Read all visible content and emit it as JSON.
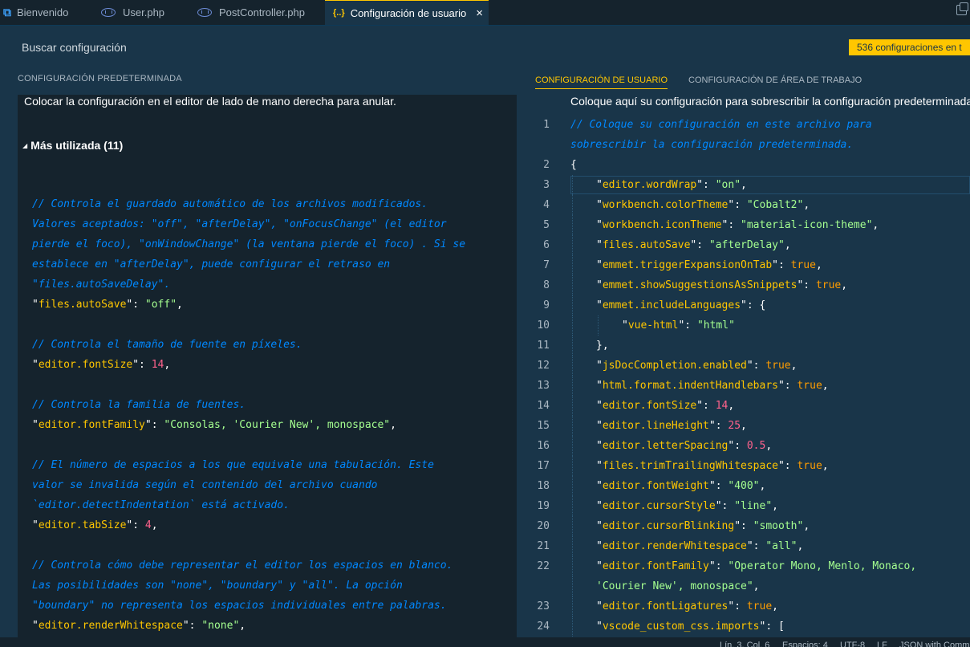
{
  "tabs": [
    {
      "label": "Bienvenido",
      "icon": "vscode-logo-icon"
    },
    {
      "label": "User.php",
      "icon": "php-icon"
    },
    {
      "label": "PostController.php",
      "icon": "php-icon"
    },
    {
      "label": "Configuración de usuario",
      "icon": "json-braces-icon",
      "active": true
    }
  ],
  "search": {
    "placeholder": "Buscar configuración",
    "count_badge": "536 configuraciones en t"
  },
  "left": {
    "header": "CONFIGURACIÓN PREDETERMINADA",
    "description": "Colocar la configuración en el editor de lado de mano derecha para anular.",
    "section": "Más utilizada (11)"
  },
  "right": {
    "tab_user": "CONFIGURACIÓN DE USUARIO",
    "tab_workspace": "CONFIGURACIÓN DE ÁREA DE TRABAJO",
    "description": "Coloque aquí su configuración para sobrescribir la configuración predeterminada"
  },
  "left_code": [
    {
      "t": "blank"
    },
    {
      "t": "comment",
      "text": "// Controla el guardado automático de los archivos modificados."
    },
    {
      "t": "comment",
      "text": "Valores aceptados: \"off\", \"afterDelay\", \"onFocusChange\" (el editor"
    },
    {
      "t": "comment",
      "text": "pierde el foco), \"onWindowChange\" (la ventana pierde el foco) . Si se"
    },
    {
      "t": "comment",
      "text": "establece en \"afterDelay\", puede configurar el retraso en"
    },
    {
      "t": "comment",
      "text": "\"files.autoSaveDelay\"."
    },
    {
      "t": "kv",
      "key": "files.autoSave",
      "val": "\"off\"",
      "vt": "str",
      "tail": ","
    },
    {
      "t": "blank"
    },
    {
      "t": "comment",
      "text": "// Controla el tamaño de fuente en píxeles."
    },
    {
      "t": "kv",
      "key": "editor.fontSize",
      "val": "14",
      "vt": "num",
      "tail": ","
    },
    {
      "t": "blank"
    },
    {
      "t": "comment",
      "text": "// Controla la familia de fuentes."
    },
    {
      "t": "kv",
      "key": "editor.fontFamily",
      "val": "\"Consolas, 'Courier New', monospace\"",
      "vt": "str",
      "tail": ","
    },
    {
      "t": "blank"
    },
    {
      "t": "comment",
      "text": "// El número de espacios a los que equivale una tabulación. Este"
    },
    {
      "t": "comment",
      "text": "valor se invalida según el contenido del archivo cuando"
    },
    {
      "t": "comment",
      "text": "`editor.detectIndentation` está activado."
    },
    {
      "t": "kv",
      "key": "editor.tabSize",
      "val": "4",
      "vt": "num",
      "tail": ","
    },
    {
      "t": "blank"
    },
    {
      "t": "comment",
      "text": "// Controla cómo debe representar el editor los espacios en blanco."
    },
    {
      "t": "comment",
      "text": "Las posibilidades son \"none\", \"boundary\" y \"all\". La opción"
    },
    {
      "t": "comment",
      "text": "\"boundary\" no representa los espacios individuales entre palabras."
    },
    {
      "t": "kv",
      "key": "editor.renderWhitespace",
      "val": "\"none\"",
      "vt": "str",
      "tail": ","
    }
  ],
  "right_code": [
    {
      "n": "1",
      "t": "comment",
      "text": "// Coloque su configuración en este archivo para"
    },
    {
      "n": "",
      "t": "comment",
      "text": "sobrescribir la configuración predeterminada."
    },
    {
      "n": "2",
      "t": "plain",
      "text": "{"
    },
    {
      "n": "3",
      "t": "kv",
      "key": "editor.wordWrap",
      "val": "\"on\"",
      "vt": "str",
      "tail": ",",
      "indent": 1,
      "current": true
    },
    {
      "n": "4",
      "t": "kv",
      "key": "workbench.colorTheme",
      "val": "\"Cobalt2\"",
      "vt": "str",
      "tail": ",",
      "indent": 1
    },
    {
      "n": "5",
      "t": "kv",
      "key": "workbench.iconTheme",
      "val": "\"material-icon-theme\"",
      "vt": "str",
      "tail": ",",
      "indent": 1
    },
    {
      "n": "6",
      "t": "kv",
      "key": "files.autoSave",
      "val": "\"afterDelay\"",
      "vt": "str",
      "tail": ",",
      "indent": 1
    },
    {
      "n": "7",
      "t": "kv",
      "key": "emmet.triggerExpansionOnTab",
      "val": "true",
      "vt": "kw",
      "tail": ",",
      "indent": 1
    },
    {
      "n": "8",
      "t": "kv",
      "key": "emmet.showSuggestionsAsSnippets",
      "val": "true",
      "vt": "kw",
      "tail": ",",
      "indent": 1
    },
    {
      "n": "9",
      "t": "kv",
      "key": "emmet.includeLanguages",
      "val": "{",
      "vt": "pun",
      "tail": "",
      "indent": 1
    },
    {
      "n": "10",
      "t": "kv",
      "key": "vue-html",
      "val": "\"html\"",
      "vt": "str",
      "tail": "",
      "indent": 2
    },
    {
      "n": "11",
      "t": "plain",
      "text": "},",
      "indent": 1
    },
    {
      "n": "12",
      "t": "kv",
      "key": "jsDocCompletion.enabled",
      "val": "true",
      "vt": "kw",
      "tail": ",",
      "indent": 1
    },
    {
      "n": "13",
      "t": "kv",
      "key": "html.format.indentHandlebars",
      "val": "true",
      "vt": "kw",
      "tail": ",",
      "indent": 1
    },
    {
      "n": "14",
      "t": "kv",
      "key": "editor.fontSize",
      "val": "14",
      "vt": "num",
      "tail": ",",
      "indent": 1
    },
    {
      "n": "15",
      "t": "kv",
      "key": "editor.lineHeight",
      "val": "25",
      "vt": "num",
      "tail": ",",
      "indent": 1
    },
    {
      "n": "16",
      "t": "kv",
      "key": "editor.letterSpacing",
      "val": "0.5",
      "vt": "num",
      "tail": ",",
      "indent": 1
    },
    {
      "n": "17",
      "t": "kv",
      "key": "files.trimTrailingWhitespace",
      "val": "true",
      "vt": "kw",
      "tail": ",",
      "indent": 1
    },
    {
      "n": "18",
      "t": "kv",
      "key": "editor.fontWeight",
      "val": "\"400\"",
      "vt": "str",
      "tail": ",",
      "indent": 1
    },
    {
      "n": "19",
      "t": "kv",
      "key": "editor.cursorStyle",
      "val": "\"line\"",
      "vt": "str",
      "tail": ",",
      "indent": 1
    },
    {
      "n": "20",
      "t": "kv",
      "key": "editor.cursorBlinking",
      "val": "\"smooth\"",
      "vt": "str",
      "tail": ",",
      "indent": 1
    },
    {
      "n": "21",
      "t": "kv",
      "key": "editor.renderWhitespace",
      "val": "\"all\"",
      "vt": "str",
      "tail": ",",
      "indent": 1
    },
    {
      "n": "22",
      "t": "kv",
      "key": "editor.fontFamily",
      "val": "\"Operator Mono, Menlo, Monaco,",
      "vt": "str",
      "tail": "",
      "indent": 1
    },
    {
      "n": "",
      "t": "strcont",
      "text": "'Courier New', monospace\"",
      "tail": ",",
      "indent": 1
    },
    {
      "n": "23",
      "t": "kv",
      "key": "editor.fontLigatures",
      "val": "true",
      "vt": "kw",
      "tail": ",",
      "indent": 1
    },
    {
      "n": "24",
      "t": "kv",
      "key": "vscode_custom_css.imports",
      "val": "[",
      "vt": "pun",
      "tail": "",
      "indent": 1
    }
  ],
  "status": {
    "position": "Lín. 3, Col. 6",
    "spaces": "Espacios: 4",
    "encoding": "UTF-8",
    "eol": "LF",
    "language": "JSON with Comm"
  },
  "colors": {
    "background": "#193549",
    "background_dark": "#15232d",
    "accent": "#ffc600",
    "comment": "#0088ff",
    "key": "#ffc600",
    "string": "#a5ff90",
    "number": "#ff628c",
    "keyword": "#ff9d00"
  }
}
